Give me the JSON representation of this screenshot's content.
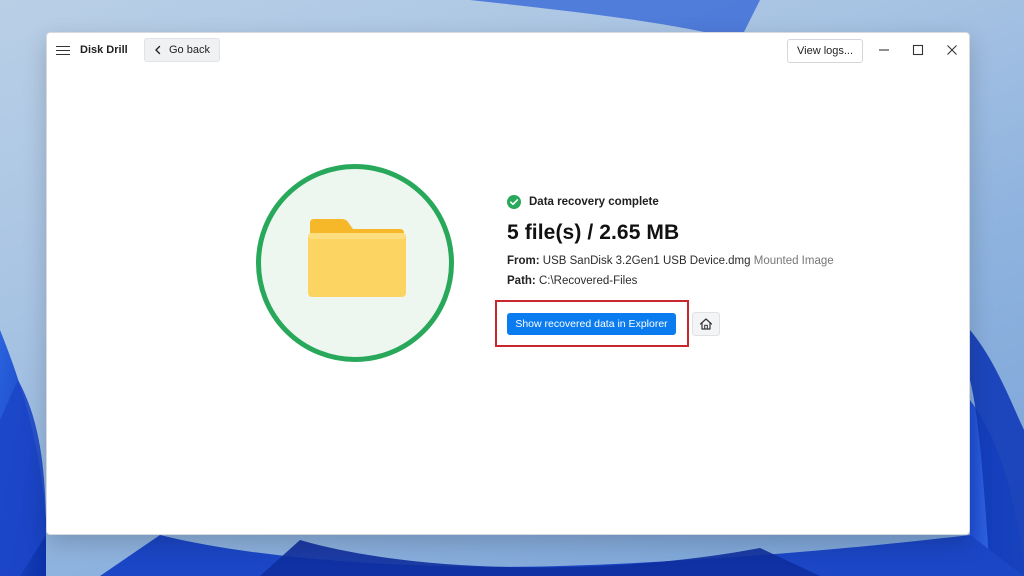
{
  "app": {
    "title": "Disk Drill"
  },
  "toolbar": {
    "go_back_label": "Go back",
    "view_logs_label": "View logs..."
  },
  "result": {
    "status": "Data recovery complete",
    "summary": "5 file(s) / 2.65 MB",
    "from_label": "From:",
    "from_value": "USB  SanDisk 3.2Gen1 USB Device.dmg",
    "from_tag": "Mounted Image",
    "path_label": "Path:",
    "path_value": "C:\\Recovered-Files"
  },
  "actions": {
    "show_in_explorer_label": "Show recovered data in Explorer",
    "home_icon": "home-icon"
  },
  "colors": {
    "accent_blue": "#0a7cf0",
    "success_green": "#27a85a",
    "highlight_red": "#c8272f",
    "folder_yellow": "#fcd462"
  }
}
